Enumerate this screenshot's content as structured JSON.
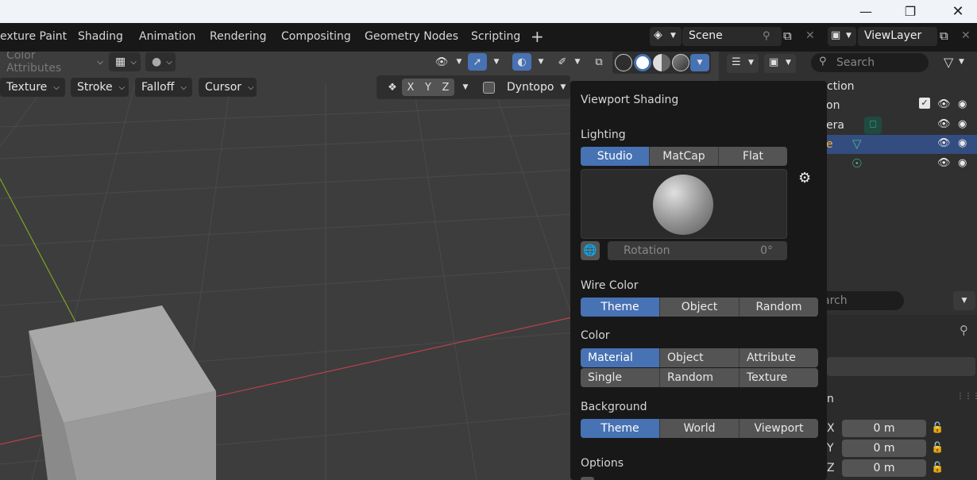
{
  "window": {
    "minimize_icon": "minimize-icon",
    "maximize_icon": "restore-icon",
    "close_icon": "close-icon"
  },
  "workspace_tabs": [
    "exture Paint",
    "Shading",
    "Animation",
    "Rendering",
    "Compositing",
    "Geometry Nodes",
    "Scripting"
  ],
  "scene": {
    "label": "Scene"
  },
  "view_layer": {
    "label": "ViewLayer"
  },
  "header_left": {
    "mode_dropdown": "Color Attributes"
  },
  "tool_header": {
    "texture": "Texture",
    "stroke": "Stroke",
    "falloff": "Falloff",
    "cursor": "Cursor",
    "axis_x": "X",
    "axis_y": "Y",
    "axis_z": "Z",
    "dyntopo": "Dyntopo"
  },
  "outliner": {
    "search_placeholder": "Search",
    "header_suffix": "ction",
    "rows": [
      {
        "label": "on",
        "selected": false
      },
      {
        "label": "era",
        "selected": false
      },
      {
        "label": "e",
        "selected": true
      },
      {
        "label": "",
        "selected": false
      }
    ]
  },
  "properties": {
    "search_placeholder": "arch",
    "section_suffix": "n",
    "location": [
      {
        "axis": "X",
        "value": "0 m"
      },
      {
        "axis": "Y",
        "value": "0 m"
      },
      {
        "axis": "Z",
        "value": "0 m"
      }
    ]
  },
  "popup": {
    "title": "Viewport Shading",
    "lighting": {
      "label": "Lighting",
      "options": [
        "Studio",
        "MatCap",
        "Flat"
      ],
      "selected": "Studio",
      "rotation_label": "Rotation",
      "rotation_value": "0°"
    },
    "wire_color": {
      "label": "Wire Color",
      "options": [
        "Theme",
        "Object",
        "Random"
      ],
      "selected": "Theme"
    },
    "color": {
      "label": "Color",
      "options": [
        "Material",
        "Object",
        "Attribute",
        "Single",
        "Random",
        "Texture"
      ],
      "selected": "Material"
    },
    "background": {
      "label": "Background",
      "options": [
        "Theme",
        "World",
        "Viewport"
      ],
      "selected": "Theme"
    },
    "options_label": "Options"
  },
  "colors": {
    "accent": "#4772b3",
    "x_axis": "#b5424b",
    "y_axis": "#7ea324",
    "camera": "#4fb69a"
  }
}
